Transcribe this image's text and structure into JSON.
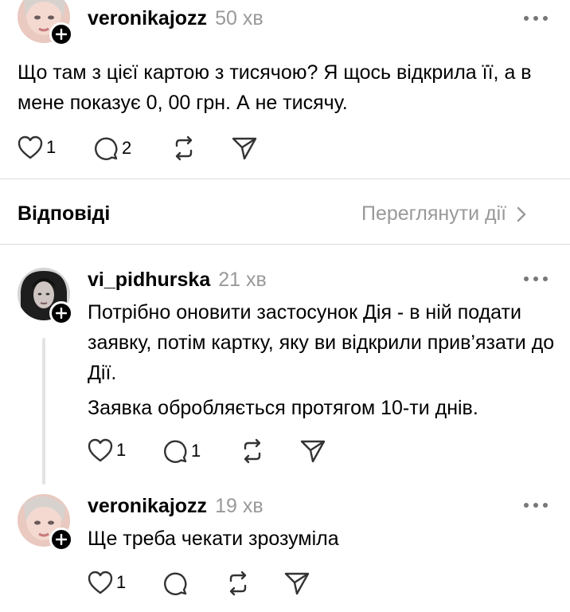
{
  "post": {
    "username": "veronikajozz",
    "time": "50 хв",
    "text": "Що там з цієї картою з тисячою? Я щось відкрила її, а в мене показує 0, 00 грн. А не тисячу.",
    "likes": "1",
    "replies": "2"
  },
  "replies_header": {
    "title": "Відповіді",
    "view_activity": "Переглянути дії"
  },
  "replies": [
    {
      "username": "vi_pidhurska",
      "time": "21 хв",
      "text": "Потрібно оновити застосунок Дія - в ній подати заявку, потім картку, яку ви відкрили прив’язати до Дії.",
      "text2": "Заявка обробляється протягом 10-ти днів.",
      "likes": "1",
      "replies": "1"
    },
    {
      "username": "veronikajozz",
      "time": "19 хв",
      "text": "Ще треба чекати зрозуміла",
      "likes": "1",
      "replies": ""
    }
  ],
  "colors": {
    "muted": "#999999",
    "icon": "#333333",
    "badge": "#000000"
  }
}
